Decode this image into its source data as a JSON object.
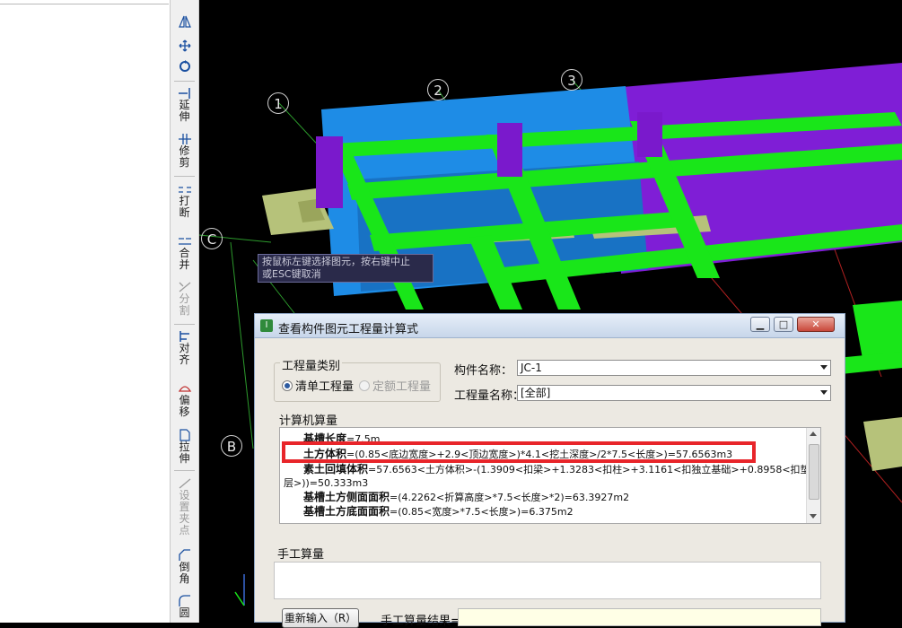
{
  "toolbar": {
    "tools": [
      {
        "label": "延伸",
        "icon": "extend-icon"
      },
      {
        "label": "修剪",
        "icon": "trim-icon"
      },
      {
        "label": "打断",
        "icon": "break-icon"
      },
      {
        "label": "合并",
        "icon": "merge-icon"
      },
      {
        "label": "分割",
        "icon": "split-icon"
      },
      {
        "label": "对齐",
        "icon": "align-icon"
      },
      {
        "label": "偏移",
        "icon": "offset-icon"
      },
      {
        "label": "拉伸",
        "icon": "stretch-icon"
      },
      {
        "label": "设置夹点",
        "icon": "grip-icon"
      },
      {
        "label": "倒角",
        "icon": "chamfer-icon"
      },
      {
        "label": "圆",
        "icon": "round-icon"
      }
    ]
  },
  "viewport": {
    "axis_labels": [
      "1",
      "2",
      "3",
      "C",
      "B"
    ],
    "tooltip": {
      "line1": "按鼠标左键选择图元，按右键中止",
      "line2": "或ESC键取消"
    }
  },
  "dialog": {
    "title": "查看构件图元工程量计算式",
    "quantity_type": {
      "label": "工程量类别",
      "option1": "清单工程量",
      "option2": "定额工程量"
    },
    "component_name": {
      "label": "构件名称：",
      "value": "JC-1"
    },
    "quantity_name": {
      "label": "工程量名称：",
      "value": "[全部]"
    },
    "calc": {
      "label": "计算机算量",
      "lines": [
        {
          "name": "基槽长度",
          "formula": "=7.5m"
        },
        {
          "name": "土方体积",
          "formula": "=(0.85<底边宽度>+2.9<顶边宽度>)*4.1<挖土深度>/2*7.5<长度>)=57.6563m3"
        },
        {
          "name": "素土回填体积",
          "formula": "=57.6563<土方体积>-(1.3909<扣梁>+1.3283<扣柱>+3.1161<扣独立基础>+0.8958<扣垫"
        },
        {
          "name": "",
          "formula": "层>))=50.333m3"
        },
        {
          "name": "基槽土方侧面面积",
          "formula": "=(4.2262<折算高度>*7.5<长度>*2)=63.3927m2"
        },
        {
          "name": "基槽土方底面面积",
          "formula": "=(0.85<宽度>*7.5<长度>)=6.375m2"
        }
      ]
    },
    "manual": {
      "label": "手工算量",
      "reinput_button": "重新输入（R）",
      "result_label": "手工算量结果="
    }
  },
  "colors": {
    "highlight": "#e8252a",
    "green": "#19e619",
    "purple": "#8a1ee6",
    "blue": "#1e8ce6"
  }
}
